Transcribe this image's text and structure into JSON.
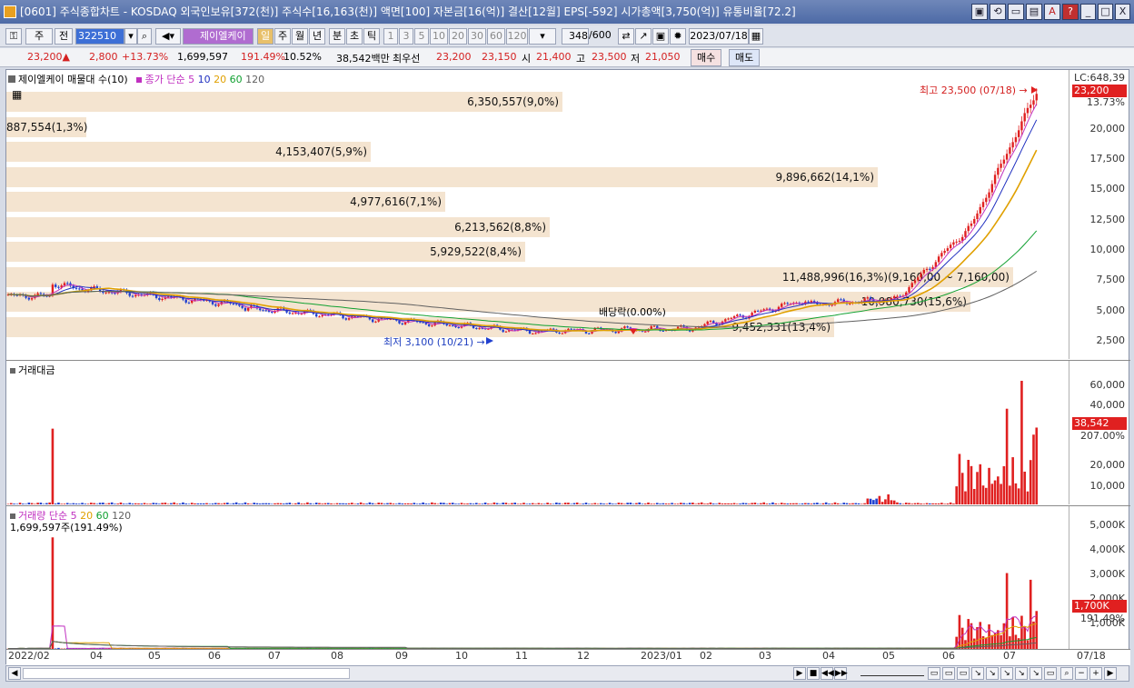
{
  "window": {
    "title": "[0601] 주식종합차트 - KOSDAQ 외국인보유[372(천)] 주식수[16,163(천)] 액면[100] 자본금[16(억)] 결산[12월] EPS[-592] 시가총액[3,750(억)] 유통비율[72.2]",
    "buttons": [
      "▣",
      "⟲",
      "▭",
      "▤",
      "A",
      "?",
      "_",
      "□",
      "X"
    ]
  },
  "toolbar": {
    "market": "주",
    "prev": "전",
    "code": "322510",
    "stock_name": "제이엘케이",
    "periods": [
      "일",
      "주",
      "월",
      "년",
      "분",
      "초",
      "틱"
    ],
    "intervals": [
      "1",
      "3",
      "5",
      "10",
      "20",
      "30",
      "60",
      "120"
    ],
    "count": "348",
    "count_max": "/600",
    "date": "2023/07/18"
  },
  "quote": {
    "price": "23,200▲",
    "change": "2,800",
    "change_pct": "+13.73%",
    "volume": "1,699,597",
    "volume_ratio": "191.49%",
    "turnover": "10.52%",
    "amount": "38,542백만",
    "best_bid_label": "최우선",
    "best_ask": "23,200",
    "best_bid": "23,150",
    "open_label": "시",
    "open": "21,400",
    "high_label": "고",
    "high": "23,500",
    "low_label": "저",
    "low": "21,050",
    "buy": "매수",
    "sell": "매도"
  },
  "panels": {
    "price": {
      "legend_name": "제이엘케이 매물대 수(10)",
      "ma_label": "종가 단순",
      "ma": [
        "5",
        "10",
        "20",
        "60",
        "120"
      ],
      "ma_colors": [
        "#c030c0",
        "#2030c0",
        "#e0a000",
        "#10a030",
        "#606060"
      ],
      "lc": "LC:648,39",
      "last": "23,200",
      "last_pct": "13.73%",
      "high_note": "최고 23,500 (07/18) →",
      "low_note": "최저 3,100 (10/21) →",
      "div_note": "배당락(0.00%)"
    },
    "amount": {
      "legend": "거래대금",
      "last": "38,542",
      "last_pct": "207.00%"
    },
    "volume": {
      "legend": "거래량",
      "ma_label": "단순",
      "ma": [
        "5",
        "20",
        "60",
        "120"
      ],
      "line2": "1,699,597주(191.49%)",
      "last": "1,700K",
      "last_pct": "191.49%"
    }
  },
  "volume_profile": [
    {
      "label": "6,350,557(9,0%)",
      "frac": 0.0,
      "width_pct": 0.9
    },
    {
      "label": "887,554(1,3%)",
      "frac": 0.1,
      "width_pct": 0.13
    },
    {
      "label": "4,153,407(5,9%)",
      "frac": 0.2,
      "width_pct": 0.59
    },
    {
      "label": "9,896,662(14,1%)",
      "frac": 0.3,
      "width_pct": 1.41
    },
    {
      "label": "4,977,616(7,1%)",
      "frac": 0.4,
      "width_pct": 0.71
    },
    {
      "label": "6,213,562(8,8%)",
      "frac": 0.5,
      "width_pct": 0.88
    },
    {
      "label": "5,929,522(8,4%)",
      "frac": 0.6,
      "width_pct": 0.84
    },
    {
      "label": "11,488,996(16,3%)(9,160,00 ~ 7,160,00)",
      "frac": 0.7,
      "width_pct": 1.63
    },
    {
      "label": "10,980,730(15,6%)",
      "frac": 0.8,
      "width_pct": 1.56
    },
    {
      "label": "9,452,331(13,4%)",
      "frac": 0.9,
      "width_pct": 1.34
    }
  ],
  "axes": {
    "price_ticks": [
      "20,000",
      "17,500",
      "15,000",
      "12,500",
      "10,000",
      "7,500",
      "5,000",
      "2,500"
    ],
    "amount_ticks": [
      "60,000",
      "40,000",
      "20,000",
      "10,000"
    ],
    "volume_ticks": [
      "5,000K",
      "4,000K",
      "3,000K",
      "2,000K",
      "1,000K"
    ],
    "x_ticks": [
      "2022/02",
      "04",
      "05",
      "06",
      "07",
      "08",
      "09",
      "10",
      "11",
      "12",
      "2023/01",
      "02",
      "03",
      "04",
      "05",
      "06",
      "07"
    ],
    "x_last": "07/18"
  }
}
